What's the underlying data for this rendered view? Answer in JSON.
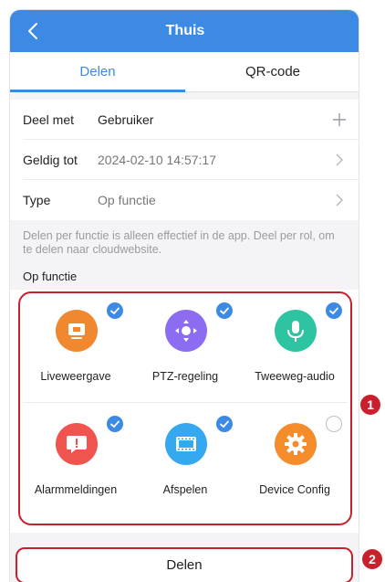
{
  "header": {
    "title": "Thuis"
  },
  "tabs": [
    {
      "label": "Delen"
    },
    {
      "label": "QR-code"
    }
  ],
  "form": {
    "share_with": {
      "label": "Deel met",
      "value": "Gebruiker"
    },
    "valid_until": {
      "label": "Geldig tot",
      "value": "2024-02-10 14:57:17"
    },
    "type": {
      "label": "Type",
      "value": "Op functie"
    }
  },
  "note": "Delen per functie is alleen effectief in de app. Deel per rol, om te delen naar cloudwebsite.",
  "mode_label": "Op functie",
  "functions": [
    {
      "label": "Liveweergave",
      "icon": "monitor-icon",
      "color": "#f0882f",
      "checked": true
    },
    {
      "label": "PTZ-regeling",
      "icon": "ptz-icon",
      "color": "#8c6cf0",
      "checked": true
    },
    {
      "label": "Tweeweg-audio",
      "icon": "microphone-icon",
      "color": "#2ec4a1",
      "checked": true
    },
    {
      "label": "Alarmmeldingen",
      "icon": "alarm-icon",
      "color": "#f0544e",
      "checked": true
    },
    {
      "label": "Afspelen",
      "icon": "film-icon",
      "color": "#35a9f0",
      "checked": true
    },
    {
      "label": "Device Config",
      "icon": "gear-icon",
      "color": "#f58c2c",
      "checked": false
    }
  ],
  "share_button": {
    "label": "Delen"
  },
  "callouts": [
    "1",
    "2"
  ],
  "colors": {
    "accent": "#3d8ae5",
    "highlight": "#c8202c"
  }
}
